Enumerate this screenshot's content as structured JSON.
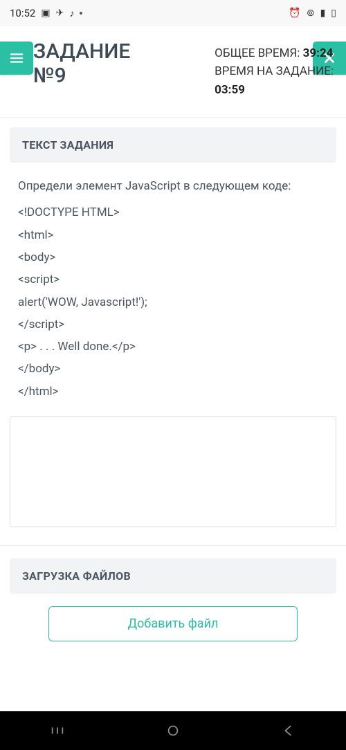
{
  "status": {
    "time": "10:52",
    "icons_left": [
      "image-icon",
      "telegram-icon",
      "tiktok-icon"
    ],
    "icons_right": [
      "alarm-icon",
      "wifi-icon",
      "signal-icon",
      "battery-icon"
    ]
  },
  "header": {
    "title_line1": "ЗАДАНИЕ",
    "title_line2": "№9",
    "total_time_label": "ОБЩЕЕ ВРЕМЯ: ",
    "total_time_value": "39:24",
    "task_time_label": "ВРЕМЯ НА ЗАДАНИЕ:",
    "task_time_value": "03:59"
  },
  "sections": {
    "task_text_header": "ТЕКСТ ЗАДАНИЯ",
    "upload_header": "ЗАГРУЗКА ФАЙЛОВ",
    "add_file_label": "Добавить файл"
  },
  "task": {
    "prompt": "Определи элемент JavaScript в следующем коде:",
    "code_lines": [
      "<!DOCTYPE HTML>",
      "<html>",
      "<body>",
      "<script>",
      "alert('WOW, Javascript!');",
      "</script>",
      "<p> . . . Well done.</p>",
      "</body>",
      "</html>"
    ]
  },
  "answer_value": ""
}
